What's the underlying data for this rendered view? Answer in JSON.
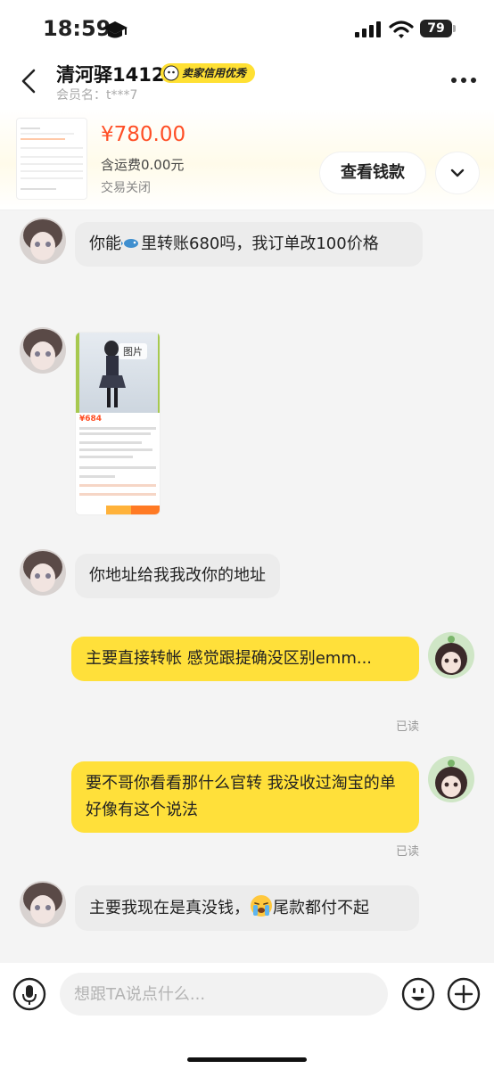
{
  "status_bar": {
    "time": "18:59",
    "battery": "79"
  },
  "header": {
    "title": "清河驿1412",
    "badge": "卖家信用优秀",
    "member": "会员名：t***7"
  },
  "product": {
    "price": "¥780.00",
    "shipping": "含运费0.00元",
    "status": "交易关闭",
    "view_money_button": "查看钱款"
  },
  "messages": [
    {
      "side": "in",
      "text_before": "你能",
      "text_after": "里转账680吗，我订单改100价格"
    },
    {
      "side": "in",
      "type": "image",
      "image_label": "图片",
      "image_price": "¥684"
    },
    {
      "side": "in",
      "text": "你地址给我我改你的地址"
    },
    {
      "side": "out",
      "text": "主要直接转帐 感觉跟提确没区别emm...",
      "read": "已读"
    },
    {
      "side": "out",
      "text": "要不哥你看看那什么官转 我没收过淘宝的单 好像有这个说法",
      "read": "已读"
    },
    {
      "side": "in",
      "text_before": "主要我现在是真没钱，",
      "text_after": "尾款都付不起"
    }
  ],
  "input": {
    "placeholder": "想跟TA说点什么..."
  },
  "icons": {
    "mic": "microphone-icon",
    "emoji": "emoji-icon",
    "plus": "plus-icon",
    "back": "back-arrow-icon",
    "more": "more-icon",
    "expand": "chevron-down-icon"
  },
  "colors": {
    "accent": "#ffe03a",
    "price": "#ff4e25",
    "badge": "#ffe033"
  }
}
